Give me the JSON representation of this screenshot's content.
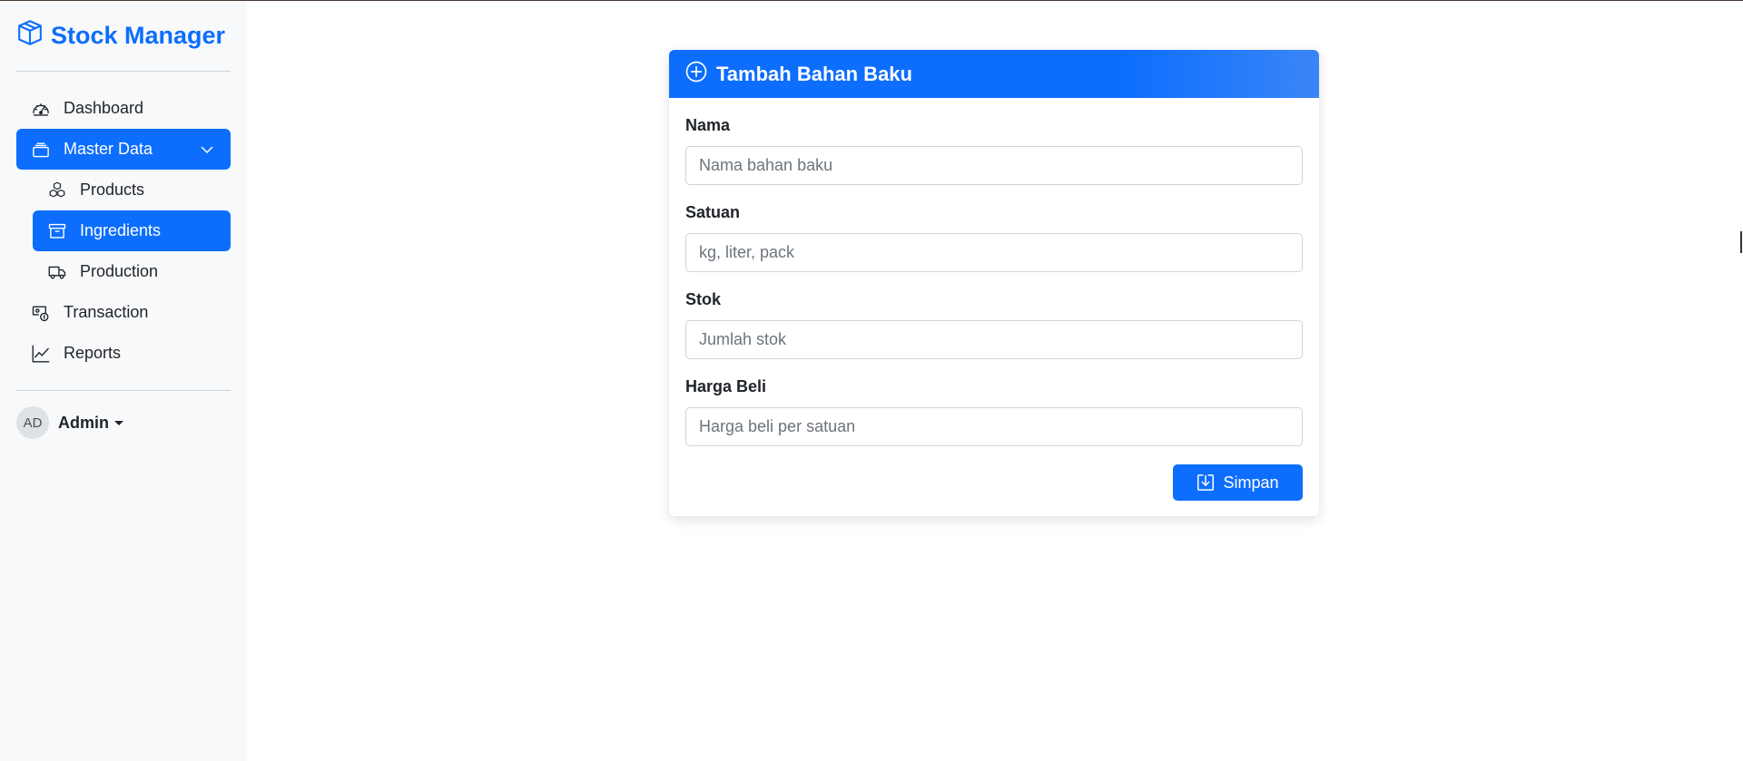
{
  "app": {
    "brand": "Stock Manager",
    "brand_icon": "box-icon",
    "accent_color": "#0d6efd"
  },
  "sidebar": {
    "items": [
      {
        "label": "Dashboard",
        "icon": "speedometer-icon",
        "active": false
      },
      {
        "label": "Master Data",
        "icon": "stack-icon",
        "active": true,
        "expanded": true
      },
      {
        "label": "Products",
        "icon": "boxes-icon",
        "active": false,
        "sub": true
      },
      {
        "label": "Ingredients",
        "icon": "archive-icon",
        "active": true,
        "sub": true
      },
      {
        "label": "Production",
        "icon": "truck-icon",
        "active": false,
        "sub": true
      },
      {
        "label": "Transaction",
        "icon": "cash-coin-icon",
        "active": false
      },
      {
        "label": "Reports",
        "icon": "graph-up-icon",
        "active": false
      }
    ],
    "user": {
      "initials": "AD",
      "name": "Admin"
    }
  },
  "form": {
    "title": "Tambah Bahan Baku",
    "title_icon": "plus-circle-icon",
    "fields": [
      {
        "label": "Nama",
        "placeholder": "Nama bahan baku",
        "value": ""
      },
      {
        "label": "Satuan",
        "placeholder": "kg, liter, pack",
        "value": ""
      },
      {
        "label": "Stok",
        "placeholder": "Jumlah stok",
        "value": ""
      },
      {
        "label": "Harga Beli",
        "placeholder": "Harga beli per satuan",
        "value": ""
      }
    ],
    "submit_label": "Simpan",
    "submit_icon": "download-icon"
  }
}
